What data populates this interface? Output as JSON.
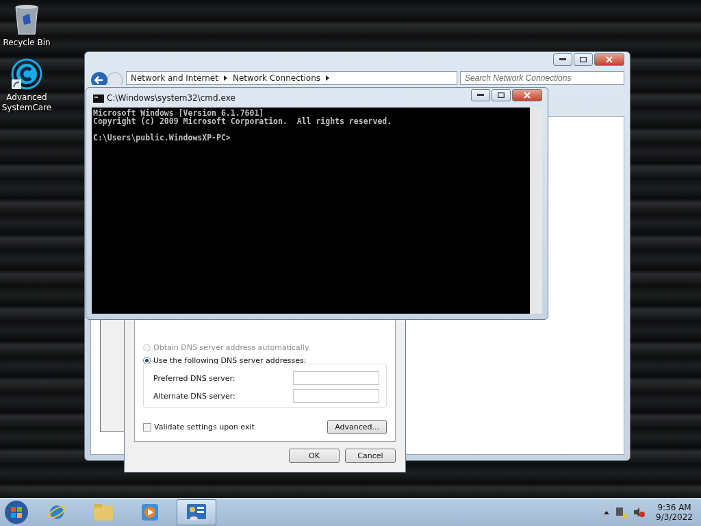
{
  "desktop_icons": [
    {
      "label": "Recycle Bin",
      "kind": "recycle"
    },
    {
      "label": "Advanced SystemCare",
      "kind": "app"
    }
  ],
  "explorer": {
    "breadcrumbs": [
      "Network and Internet",
      "Network Connections"
    ],
    "search": {
      "placeholder": "Search Network Connections"
    }
  },
  "cmd": {
    "title": "C:\\Windows\\system32\\cmd.exe",
    "blocks": [
      [
        "Microsoft Windows [Version 6.1.7601]",
        "Copyright (c) 2009 Microsoft Corporation.  All rights reserved."
      ],
      [
        "C:\\Users\\public.WindowsXP-PC>"
      ]
    ]
  },
  "dialog": {
    "dns_options": [
      {
        "label": "Obtain DNS server address automatically",
        "selected": false,
        "disabled": true
      },
      {
        "label": "Use the following DNS server addresses:",
        "selected": true,
        "disabled": false
      }
    ],
    "dns_fields": [
      {
        "label": "Preferred DNS server:"
      },
      {
        "label": "Alternate DNS server:"
      }
    ],
    "validate": {
      "label": "Validate settings upon exit",
      "checked": false
    },
    "advanced_button": "Advanced...",
    "buttons": [
      "OK",
      "Cancel"
    ]
  },
  "taskbar": {
    "apps": [
      {
        "kind": "browser",
        "active": false
      },
      {
        "kind": "folder",
        "active": false
      },
      {
        "kind": "media",
        "active": false
      },
      {
        "kind": "control",
        "active": true
      }
    ],
    "time": "9:36 AM",
    "date": "9/3/2022"
  }
}
